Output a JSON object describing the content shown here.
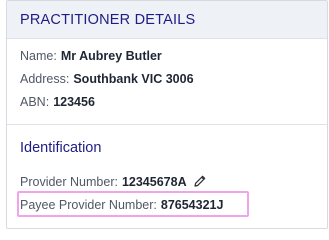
{
  "panel": {
    "title": "PRACTITIONER DETAILS"
  },
  "details": {
    "name_label": "Name:",
    "name_value": "Mr Aubrey Butler",
    "address_label": "Address:",
    "address_value": "Southbank VIC 3006",
    "abn_label": "ABN:",
    "abn_value": "123456"
  },
  "identification": {
    "title": "Identification",
    "provider_number_label": "Provider Number:",
    "provider_number_value": "12345678A",
    "payee_provider_number_label": "Payee Provider Number:",
    "payee_provider_number_value": "87654321J"
  },
  "icons": {
    "edit": "pencil-icon"
  },
  "colors": {
    "heading": "#1f1c85",
    "highlight_border": "#f2a4ea",
    "header_bg": "#eef1f5"
  }
}
